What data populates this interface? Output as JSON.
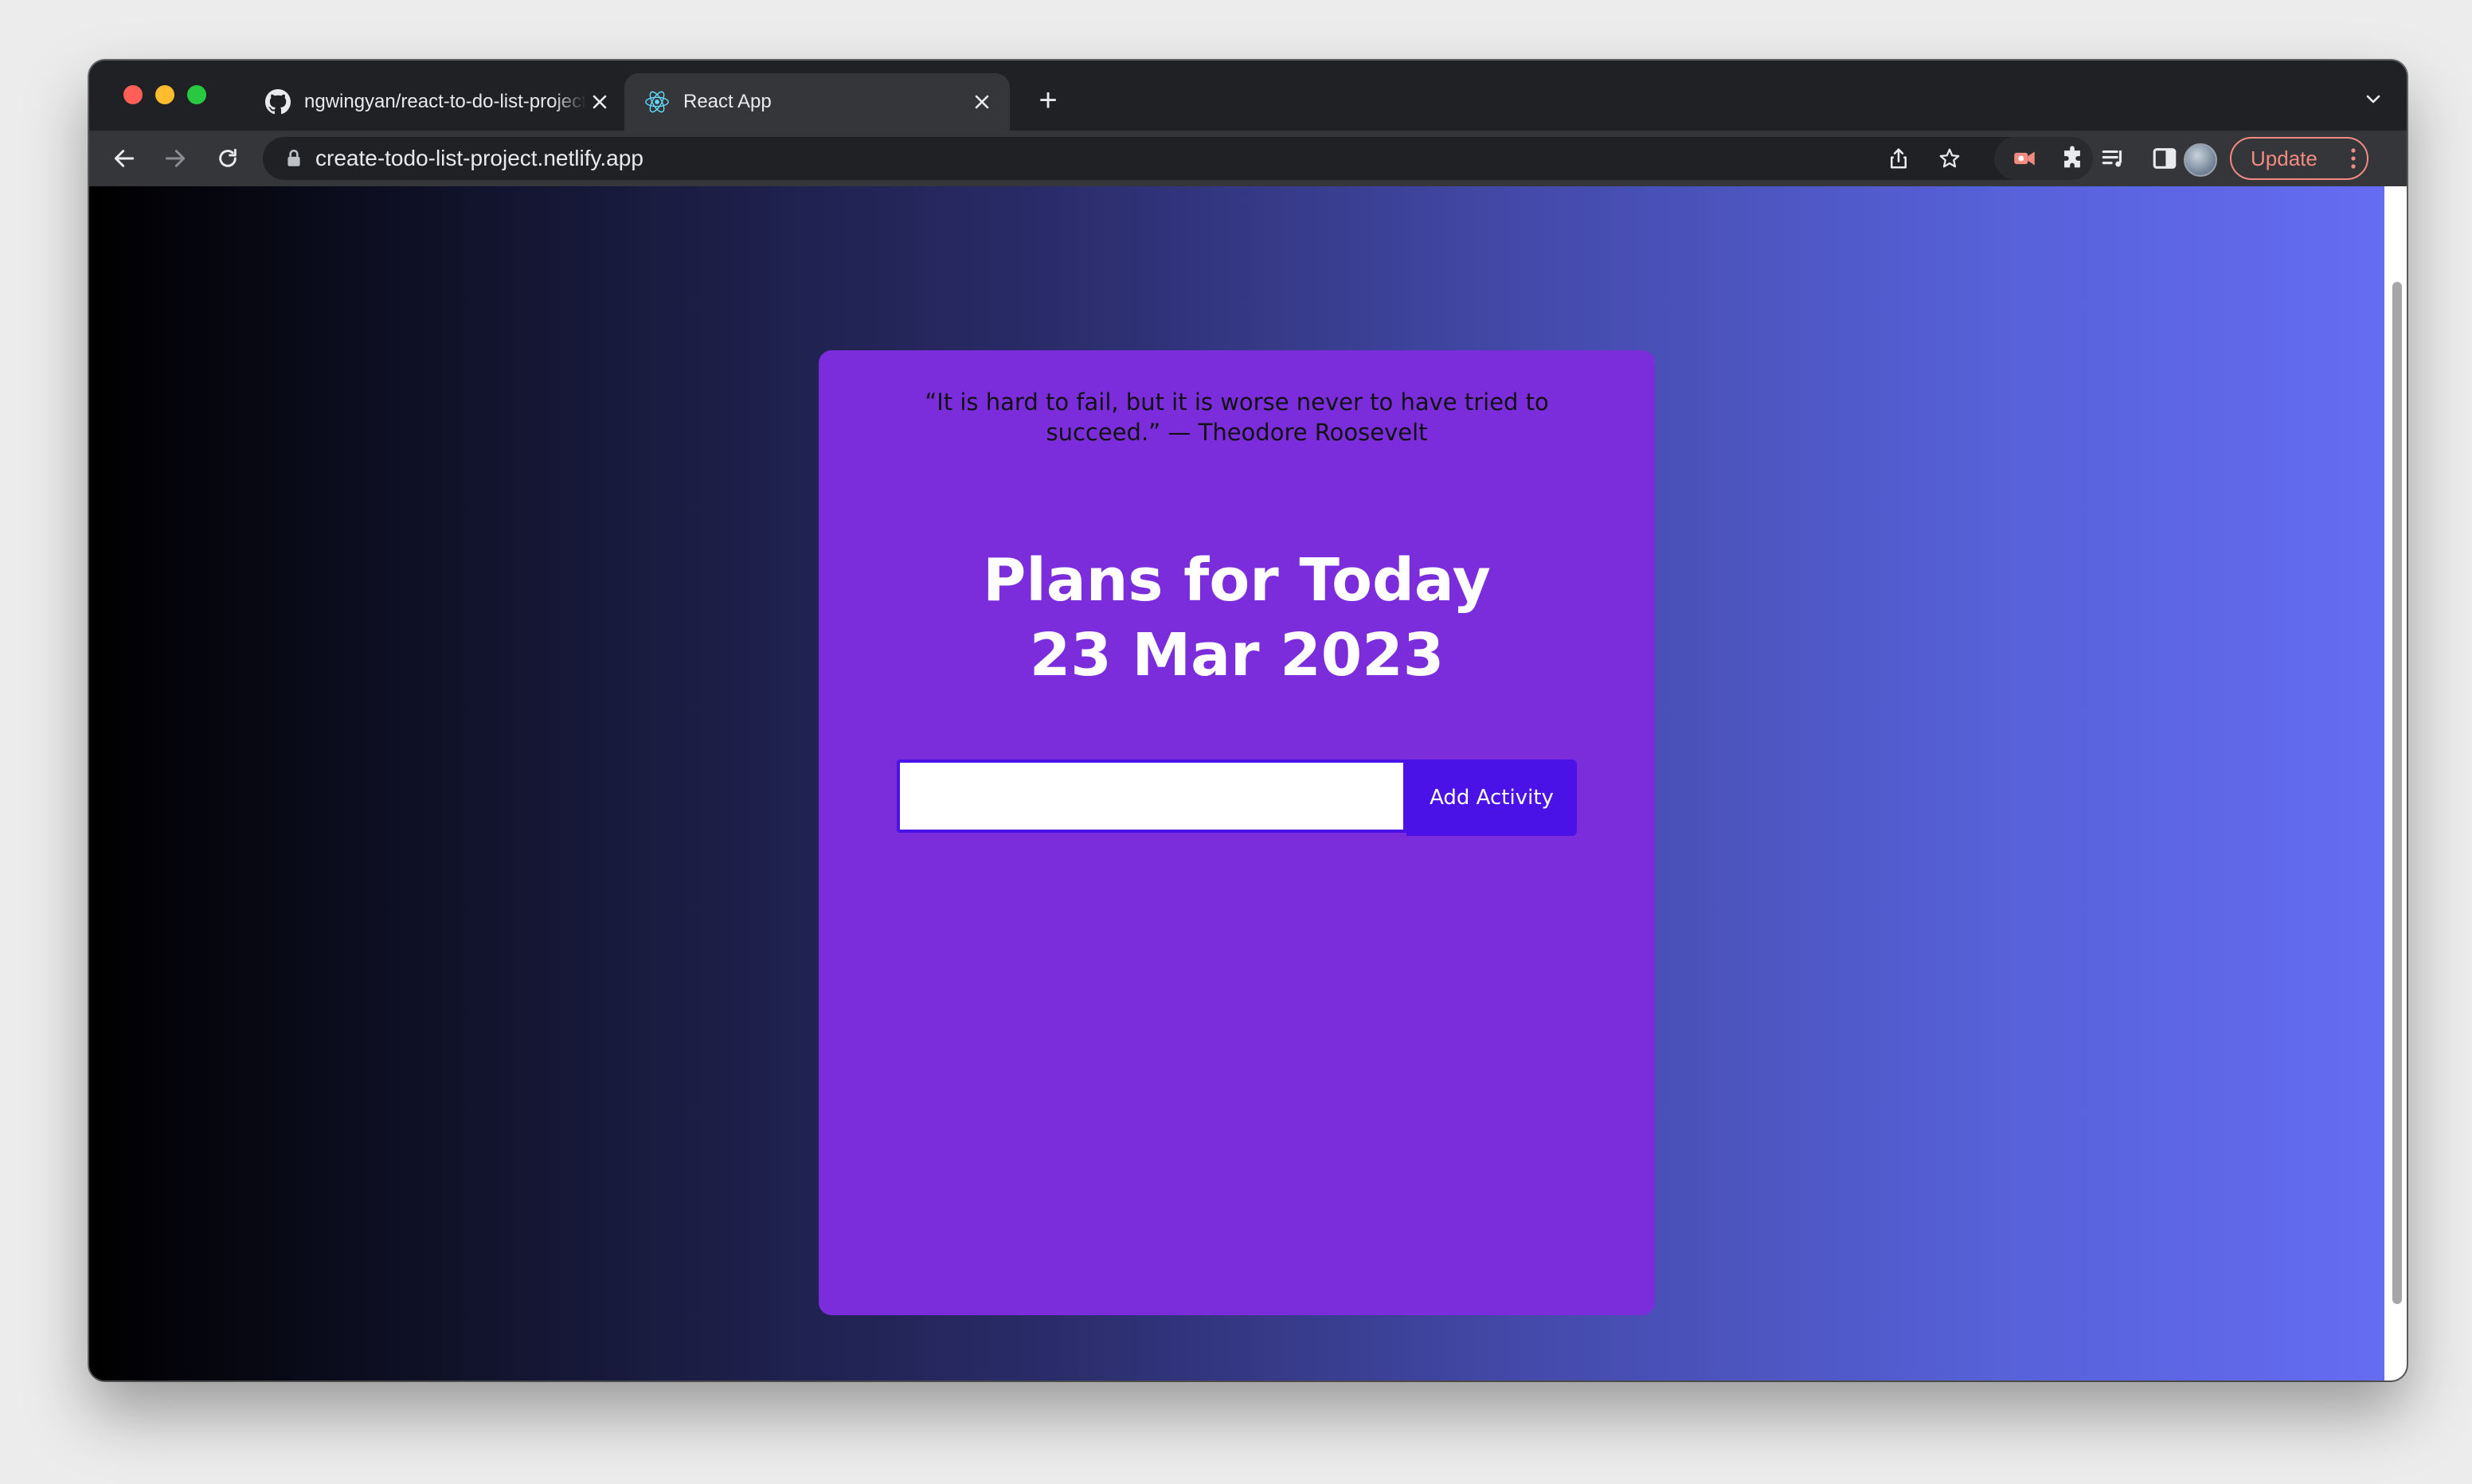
{
  "browser": {
    "tabs": [
      {
        "title": "ngwingyan/react-to-do-list-project",
        "active": false
      },
      {
        "title": "React App",
        "active": true
      }
    ],
    "new_tab_symbol": "+",
    "address": "create-todo-list-project.netlify.app",
    "update_label": "Update"
  },
  "app": {
    "quote": "“It is hard to fail, but it is worse never to have tried to succeed.” — Theodore Roosevelt",
    "heading_line1": "Plans for Today",
    "heading_line2": "23 Mar 2023",
    "input_value": "",
    "add_button_label": "Add Activity"
  },
  "colors": {
    "card": "#7c2ddb",
    "button": "#4a12e6",
    "background_left": "#000000",
    "background_right": "#656cf2"
  },
  "icons": {
    "tab1_favicon": "github-icon",
    "tab2_favicon": "react-icon",
    "back": "back-arrow-icon",
    "forward": "forward-arrow-icon",
    "reload": "reload-icon",
    "lock": "lock-icon",
    "share": "share-icon",
    "bookmark": "star-icon",
    "extension": "puzzle-icon",
    "reading_list": "reading-list-icon",
    "side_panel": "side-panel-icon"
  }
}
